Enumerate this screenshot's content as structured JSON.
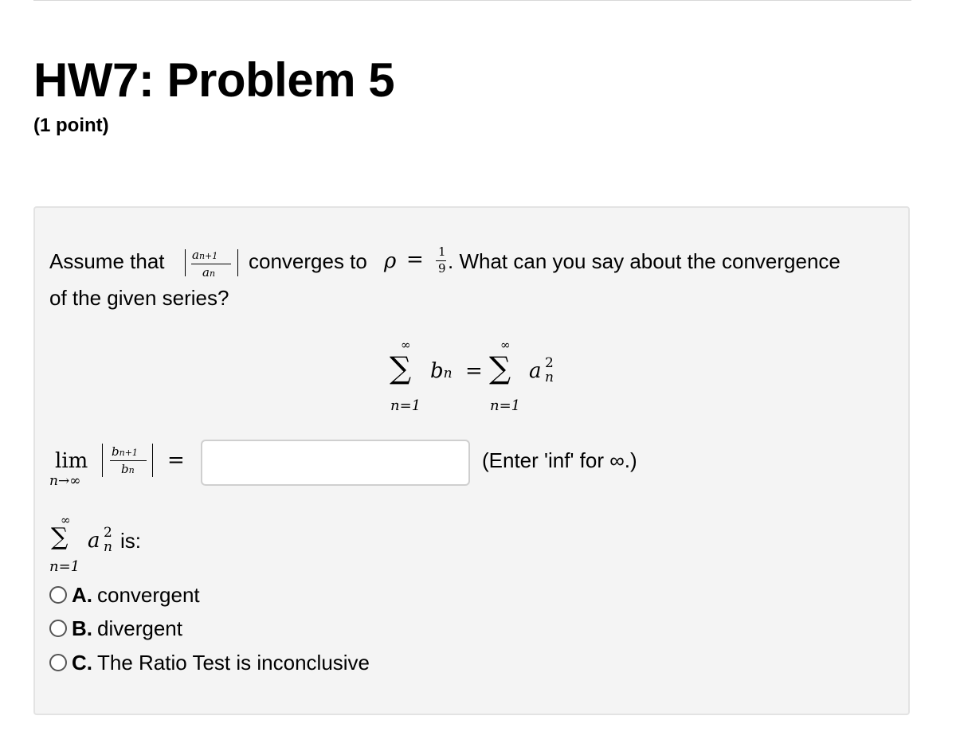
{
  "header": {
    "title": "HW7: Problem 5",
    "points": "(1 point)"
  },
  "problem": {
    "intro_1": "Assume that",
    "ratio_num": "a",
    "ratio_num_sub": "n+1",
    "ratio_den": "a",
    "ratio_den_sub": "n",
    "intro_2": "converges to",
    "rho": "ρ",
    "equals": "=",
    "rho_num": "1",
    "rho_den": "9",
    "intro_3": ". What can you say about the convergence",
    "intro_4": "of the given series?"
  },
  "display_equation": {
    "sum_upper": "∞",
    "sum_lower": "n=1",
    "sigma": "∑",
    "left_term": "b",
    "left_sub": "n",
    "equals": "=",
    "right_term": "a",
    "right_sup": "2",
    "right_sub": "n"
  },
  "limit_row": {
    "lim": "lim",
    "lim_sub": "n→∞",
    "num": "b",
    "num_sub": "n+1",
    "den": "b",
    "den_sub": "n",
    "equals": "=",
    "input_value": "",
    "hint": "(Enter 'inf' for ∞.)"
  },
  "series_question": {
    "sum_upper": "∞",
    "sum_lower": "n=1",
    "sigma": "∑",
    "term": "a",
    "term_sup": "2",
    "term_sub": "n",
    "suffix": "is:"
  },
  "options": [
    {
      "letter": "A.",
      "text": "convergent"
    },
    {
      "letter": "B.",
      "text": "divergent"
    },
    {
      "letter": "C.",
      "text": "The Ratio Test is inconclusive"
    }
  ]
}
